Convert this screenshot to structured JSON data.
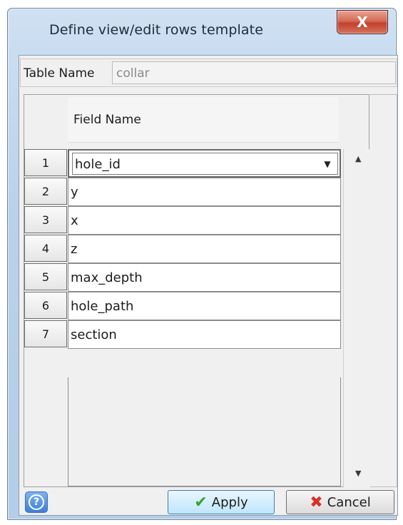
{
  "window": {
    "title": "Define view/edit rows template",
    "close_glyph": "X"
  },
  "table_name": {
    "label": "Table Name",
    "value": "collar"
  },
  "grid": {
    "column_header": "Field Name",
    "rows": [
      {
        "num": "1",
        "field": "hole_id"
      },
      {
        "num": "2",
        "field": "y"
      },
      {
        "num": "3",
        "field": "x"
      },
      {
        "num": "4",
        "field": "z"
      },
      {
        "num": "5",
        "field": "max_depth"
      },
      {
        "num": "6",
        "field": "hole_path"
      },
      {
        "num": "7",
        "field": "section"
      }
    ],
    "dropdown_icon": "chevron-down-icon",
    "scroll_up_glyph": "▲",
    "scroll_down_glyph": "▼",
    "dropdown_glyph": "▼"
  },
  "buttons": {
    "help_glyph": "?",
    "apply_label": "Apply",
    "cancel_label": "Cancel",
    "apply_icon_glyph": "✔",
    "cancel_icon_glyph": "✖"
  },
  "colors": {
    "title_bar": "#b9d1ea",
    "close_button": "#c2412c",
    "apply_button": "#bee6fd"
  }
}
